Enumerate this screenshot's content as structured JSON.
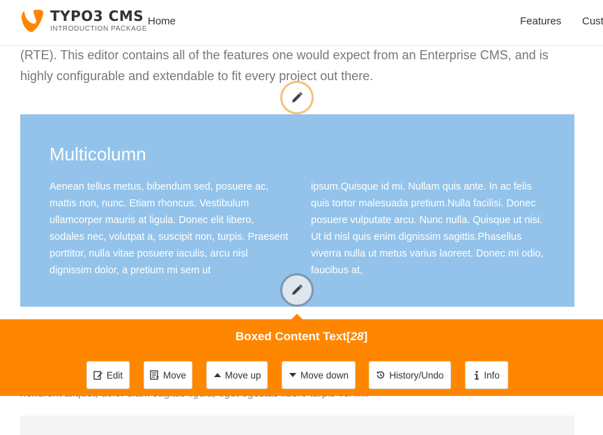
{
  "brand": {
    "name": "TYPO3 CMS",
    "tagline": "INTRODUCTION PACKAGE",
    "color": "#ff8700"
  },
  "nav": {
    "home": "Home",
    "features": "Features",
    "customers": "Cust"
  },
  "intro": {
    "text": "(RTE). This editor contains all of the features one would expect from an Enterprise CMS, and is highly configurable and extendable to fit every project out there."
  },
  "multicolumn": {
    "title": "Multicolumn",
    "left": "Aenean tellus metus, bibendum sed, posuere ac, mattis non, nunc. Etiam rhoncus. Vestibulum ullamcorper mauris at ligula. Donec elit libero, sodales nec, volutpat a, suscipit non, turpis. Praesent porttitor, nulla vitae posuere iaculis, arcu nisl dignissim dolor, a pretium mi sem ut",
    "right": "ipsum.Quisque id mi. Nullam quis ante.  In ac felis quis tortor malesuada pretium.Nulla facilisi. Donec posuere vulputate arcu. Nunc nulla. Quisque ut nisi. Ut id nisl quis enim dignissim sagittis.Phasellus viverra nulla ut metus varius laoreet. Donec mi odio, faucibus at,"
  },
  "edit_panel": {
    "title": "Boxed Content Text",
    "uid": "28",
    "buttons": {
      "edit": "Edit",
      "move": "Move",
      "move_up": "Move up",
      "move_down": "Move down",
      "history": "History/Undo",
      "info": "Info"
    }
  },
  "below": {
    "text": "hendrerit aliquet, dolor diam sagittis ligula, eget egestas libero turpis vel mi."
  },
  "icons": {
    "edit_circle_top": "pencil-icon",
    "edit_circle_mid": "pencil-icon",
    "edit": "edit-icon",
    "move": "move-icon",
    "move_up": "triangle-up-icon",
    "move_down": "triangle-down-icon",
    "history": "history-icon",
    "info": "info-icon"
  }
}
